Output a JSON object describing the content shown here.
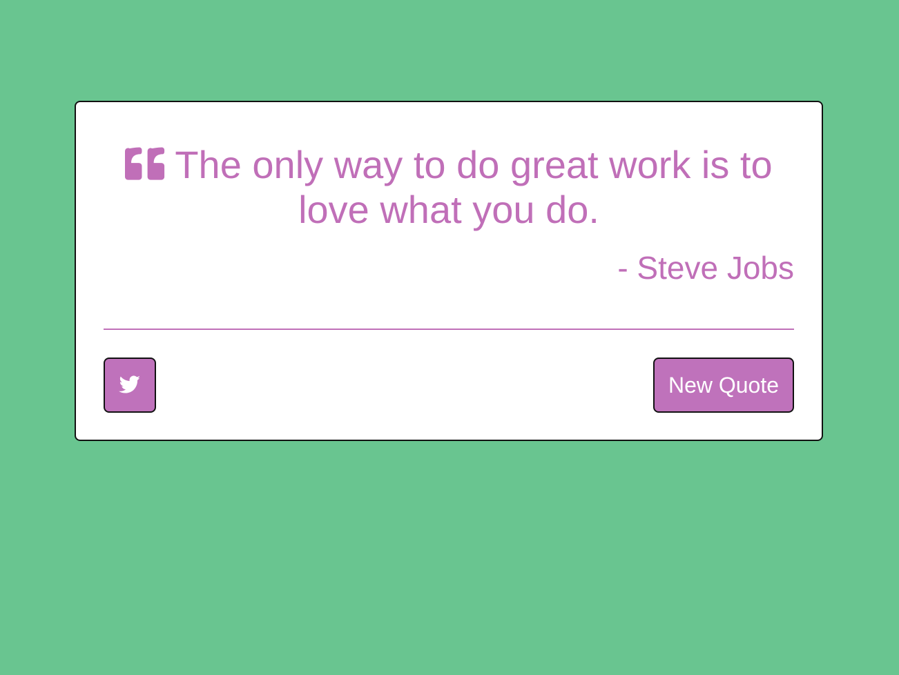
{
  "page": {
    "background_color": "#69c590",
    "accent_color": "#c06fb8"
  },
  "quote": {
    "text": "The only way to do great work is to love what you do.",
    "author": "- Steve Jobs",
    "icon": "quote-left-icon"
  },
  "actions": {
    "tweet": {
      "icon": "twitter-icon"
    },
    "new_quote": {
      "label": "New Quote"
    }
  }
}
